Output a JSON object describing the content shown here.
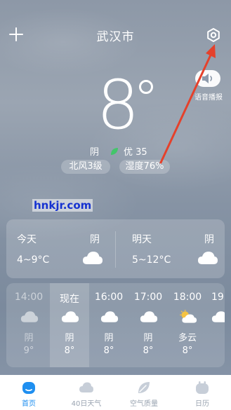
{
  "header": {
    "city": "武汉市"
  },
  "voice": {
    "label": "语音播报"
  },
  "current": {
    "temperature": "8",
    "condition": "阴",
    "aqi": "优 35",
    "wind": "北风3级",
    "humidity": "湿度76%"
  },
  "watermark": "hnkjr.com",
  "forecast": {
    "today": {
      "label": "今天",
      "condition": "阴",
      "range": "4~9°C"
    },
    "tomorrow": {
      "label": "明天",
      "condition": "阴",
      "range": "5~12°C"
    }
  },
  "hourly": [
    {
      "time": "14:00",
      "condition": "阴",
      "temp": "9°",
      "icon": "cloud-icon",
      "state": "past"
    },
    {
      "time": "现在",
      "condition": "阴",
      "temp": "8°",
      "icon": "cloud-icon",
      "state": "now"
    },
    {
      "time": "16:00",
      "condition": "阴",
      "temp": "8°",
      "icon": "cloud-icon",
      "state": "future"
    },
    {
      "time": "17:00",
      "condition": "阴",
      "temp": "8°",
      "icon": "cloud-icon",
      "state": "future"
    },
    {
      "time": "18:00",
      "condition": "多云",
      "temp": "8°",
      "icon": "partly-cloudy-icon",
      "state": "future"
    },
    {
      "time": "19",
      "condition": "",
      "temp": "",
      "icon": "cloud-icon",
      "state": "future"
    }
  ],
  "nav": [
    {
      "label": "首页",
      "icon": "home-icon",
      "active": true
    },
    {
      "label": "40日天气",
      "icon": "cloud-icon",
      "active": false
    },
    {
      "label": "空气质量",
      "icon": "leaf-icon",
      "active": false
    },
    {
      "label": "日历",
      "icon": "calendar-icon",
      "active": false
    }
  ],
  "colors": {
    "accent": "#1f8ff0",
    "annotation_arrow": "#e5412b",
    "aqi_leaf": "#43c56a",
    "watermark": "#1633d0"
  }
}
